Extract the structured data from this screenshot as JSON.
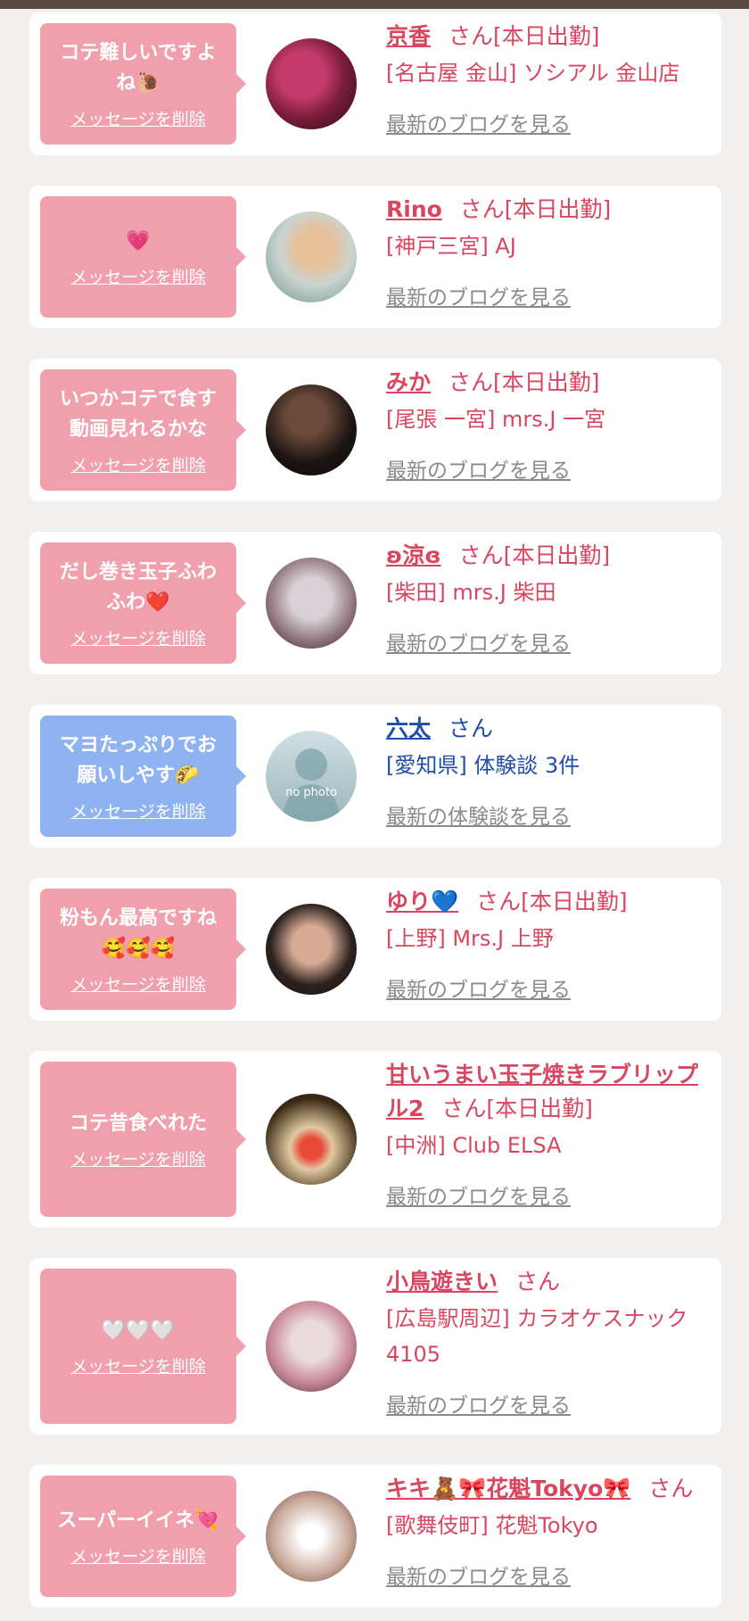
{
  "cards": [
    {
      "message": "コテ難しいですよ\nね🐌",
      "delete_label": "メッセージを削除",
      "name": "京香",
      "suffix": "さん[本日出勤]",
      "shop": "[名古屋 金山] ソシアル 金山店",
      "link": "最新のブログを見る",
      "theme": "pink",
      "avatar_colors": [
        "#7b1d3a",
        "#c43a6b",
        "#2b0a18"
      ]
    },
    {
      "message": "💗",
      "delete_label": "メッセージを削除",
      "name": "Rino",
      "suffix": "さん[本日出勤]",
      "shop": "[神戸三宮] AJ",
      "link": "最新のブログを見る",
      "theme": "pink",
      "avatar_colors": [
        "#c9d4d0",
        "#d9a07a",
        "#6f8f8a"
      ]
    },
    {
      "message": "いつかコテで食す\n動画見れるかな",
      "delete_label": "メッセージを削除",
      "name": "みか",
      "suffix": "さん[本日出勤]",
      "shop": "[尾張 一宮] mrs.J 一宮",
      "link": "最新のブログを見る",
      "theme": "pink",
      "avatar_colors": [
        "#1b1412",
        "#6b4a3a",
        "#0c0908"
      ]
    },
    {
      "message": "だし巻き玉子ふわ\nふわ❤️",
      "delete_label": "メッセージを削除",
      "name": "ʚ涼ɞ",
      "suffix": "さん[本日出勤]",
      "shop": "[柴田] mrs.J 柴田",
      "link": "最新のブログを見る",
      "theme": "pink",
      "avatar_colors": [
        "#d8d2d6",
        "#8b6f76",
        "#2a2224"
      ]
    },
    {
      "message": "マヨたっぷりでお\n願いしやす🌮",
      "delete_label": "メッセージを削除",
      "name": "六太",
      "suffix": "さん",
      "shop": "[愛知県] 体験談 3件",
      "link": "最新の体験談を見る",
      "theme": "blue",
      "avatar_text": "no photo",
      "avatar_colors": [
        "#cfe0e3",
        "#9bb5bb",
        "#7ea2aa"
      ]
    },
    {
      "message": "粉もん最高ですね\n🥰🥰🥰",
      "delete_label": "メッセージを削除",
      "name": "ゆり💙",
      "suffix": "さん[本日出勤]",
      "shop": "[上野] Mrs.J 上野",
      "link": "最新のブログを見る",
      "theme": "pink",
      "avatar_colors": [
        "#2c2220",
        "#d7aa95",
        "#1a1412"
      ]
    },
    {
      "message": "コテ昔食べれた",
      "delete_label": "メッセージを削除",
      "name": "甘いうまい玉子焼きラブリップル2",
      "suffix": "さん[本日出勤]",
      "shop": "[中洲] Club ELSA",
      "link": "最新のブログを見る",
      "theme": "pink",
      "avatar_colors": [
        "#3b2a14",
        "#e2c9a3",
        "#1e150b"
      ]
    },
    {
      "message": "🤍🤍🤍",
      "delete_label": "メッセージを削除",
      "name": "小鳥遊きい",
      "suffix": "さん",
      "shop": "[広島駅周辺] カラオケスナック 4105",
      "link": "最新のブログを見る",
      "theme": "pink",
      "avatar_colors": [
        "#e9d8dc",
        "#c98a98",
        "#3a2a2e"
      ]
    },
    {
      "message": "スーパーイイネ💘",
      "delete_label": "メッセージを削除",
      "name": "キキ🧸🎀花魁Tokyo🎀",
      "suffix": "さん",
      "shop": "[歌舞伎町] 花魁Tokyo",
      "link": "最新のブログを見る",
      "theme": "pink",
      "avatar_colors": [
        "#efe6e2",
        "#c9a89a",
        "#5a3a32"
      ]
    }
  ]
}
